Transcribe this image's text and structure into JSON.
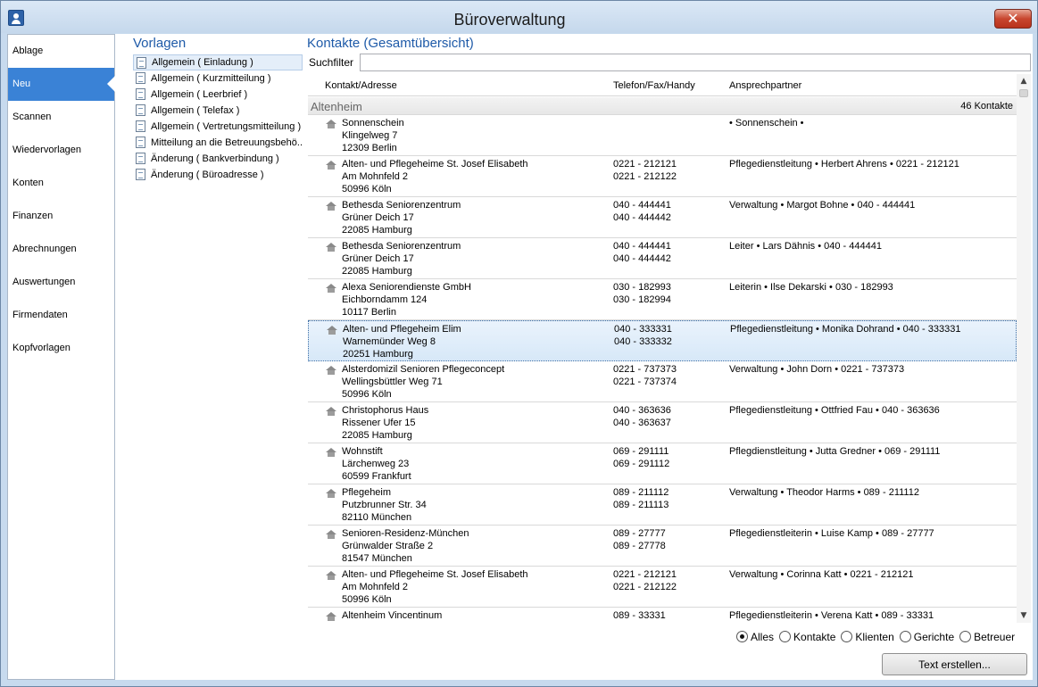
{
  "window": {
    "title": "Büroverwaltung",
    "close_glyph": "✕"
  },
  "nav": {
    "items": [
      "Ablage",
      "Neu",
      "Scannen",
      "Wiedervorlagen",
      "Konten",
      "Finanzen",
      "Abrechnungen",
      "Auswertungen",
      "Firmendaten",
      "Kopfvorlagen"
    ],
    "active_index": 1
  },
  "vorlagen": {
    "title": "Vorlagen",
    "items": [
      "Allgemein ( Einladung )",
      "Allgemein ( Kurzmitteilung )",
      "Allgemein ( Leerbrief )",
      "Allgemein ( Telefax )",
      "Allgemein ( Vertretungsmitteilung )",
      "Mitteilung an die Betreuungsbehö...",
      "Änderung ( Bankverbindung )",
      "Änderung ( Büroadresse )"
    ],
    "selected_index": 0
  },
  "kontakte": {
    "title": "Kontakte (Gesamtübersicht)",
    "filter_label": "Suchfilter",
    "filter_value": "",
    "columns": [
      "Kontakt/Adresse",
      "Telefon/Fax/Handy",
      "Ansprechpartner"
    ],
    "group": {
      "name": "Altenheim",
      "count": "46 Kontakte"
    },
    "rows": [
      {
        "name": "Sonnenschein",
        "street": "Klingelweg 7",
        "city": "12309 Berlin",
        "tel": "",
        "fax": "",
        "contact": "• Sonnenschein  •"
      },
      {
        "name": "Alten- und Pflegeheime St. Josef Elisabeth",
        "street": "Am Mohnfeld 2",
        "city": "50996 Köln",
        "tel": "0221 - 212121",
        "fax": "0221 - 212122",
        "contact": "Pflegedienstleitung • Herbert Ahrens • 0221 - 212121"
      },
      {
        "name": "Bethesda Seniorenzentrum",
        "street": "Grüner Deich 17",
        "city": "22085 Hamburg",
        "tel": "040 - 444441",
        "fax": "040 - 444442",
        "contact": "Verwaltung • Margot Bohne • 040 - 444441"
      },
      {
        "name": "Bethesda Seniorenzentrum",
        "street": "Grüner Deich 17",
        "city": "22085 Hamburg",
        "tel": "040 - 444441",
        "fax": "040 - 444442",
        "contact": "Leiter • Lars Dähnis • 040 - 444441"
      },
      {
        "name": "Alexa Seniorendienste GmbH",
        "street": "Eichborndamm 124",
        "city": "10117 Berlin",
        "tel": "030 - 182993",
        "fax": "030 - 182994",
        "contact": "Leiterin • Ilse Dekarski • 030 - 182993"
      },
      {
        "name": "Alten- und Pflegeheim Elim",
        "street": "Warnemünder Weg 8",
        "city": "20251 Hamburg",
        "tel": "040 - 333331",
        "fax": "040 - 333332",
        "contact": "Pflegedienstleitung • Monika Dohrand • 040 - 333331"
      },
      {
        "name": "Alsterdomizil Senioren Pflegeconcept",
        "street": "Wellingsbüttler Weg 71",
        "city": "50996 Köln",
        "tel": "0221 - 737373",
        "fax": "0221 - 737374",
        "contact": "Verwaltung • John Dorn • 0221 - 737373"
      },
      {
        "name": "Christophorus Haus",
        "street": "Rissener Ufer 15",
        "city": "22085 Hamburg",
        "tel": "040 - 363636",
        "fax": "040 - 363637",
        "contact": "Pflegedienstleitung • Ottfried Fau • 040 - 363636"
      },
      {
        "name": "Wohnstift",
        "street": "Lärchenweg 23",
        "city": "60599 Frankfurt",
        "tel": "069 - 291111",
        "fax": "069 - 291112",
        "contact": "Pflegdienstleitung • Jutta Gredner • 069 - 291111"
      },
      {
        "name": "Pflegeheim",
        "street": "Putzbrunner Str. 34",
        "city": "82110 München",
        "tel": "089 - 211112",
        "fax": "089 - 211113",
        "contact": "Verwaltung • Theodor Harms • 089 - 211112"
      },
      {
        "name": "Senioren-Residenz-München",
        "street": "Grünwalder Straße 2",
        "city": "81547 München",
        "tel": "089 - 27777",
        "fax": "089 - 27778",
        "contact": "Pflegedienstleiterin • Luise Kamp • 089 - 27777"
      },
      {
        "name": "Alten- und Pflegeheime St. Josef Elisabeth",
        "street": "Am Mohnfeld 2",
        "city": "50996 Köln",
        "tel": "0221 - 212121",
        "fax": "0221 - 212122",
        "contact": "Verwaltung • Corinna Katt • 0221 - 212121"
      },
      {
        "name": "Altenheim Vincentinum",
        "street": "",
        "city": "",
        "tel": "089 - 33331",
        "fax": "",
        "contact": "Pflegedienstleiterin • Verena Katt • 089 - 33331"
      }
    ],
    "selected_row": 5
  },
  "filters": {
    "options": [
      "Alles",
      "Kontakte",
      "Klienten",
      "Gerichte",
      "Betreuer"
    ],
    "selected_index": 0
  },
  "actions": {
    "create_label": "Text erstellen..."
  },
  "icons": {
    "row_icon": "house-icon",
    "template_icon": "document-icon",
    "app_icon": "user-icon"
  },
  "colors": {
    "accent": "#3a82d6",
    "heading": "#1e5aa8"
  }
}
